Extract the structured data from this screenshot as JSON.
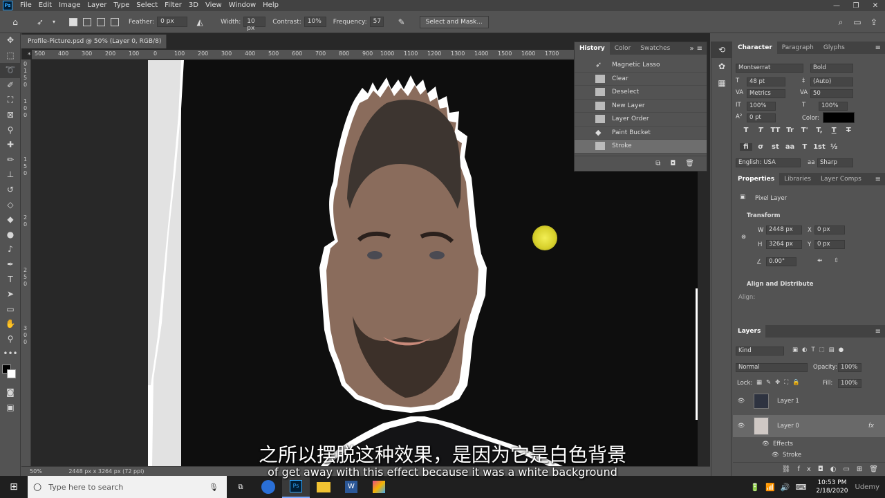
{
  "menubar": {
    "app_icon": "Ps",
    "items": [
      "File",
      "Edit",
      "Image",
      "Layer",
      "Type",
      "Select",
      "Filter",
      "3D",
      "View",
      "Window",
      "Help"
    ]
  },
  "options_bar": {
    "feather_label": "Feather:",
    "feather_value": "0 px",
    "width_label": "Width:",
    "width_value": "10 px",
    "contrast_label": "Contrast:",
    "contrast_value": "10%",
    "frequency_label": "Frequency:",
    "frequency_value": "57",
    "select_mask_label": "Select and Mask..."
  },
  "document": {
    "tab_title": "Profile-Picture.psd @ 50% (Layer 0, RGB/8) *",
    "ruler_h_labels": [
      "500",
      "400",
      "300",
      "200",
      "100",
      "0",
      "100",
      "200",
      "300",
      "400",
      "500",
      "600",
      "700",
      "800",
      "900",
      "1000",
      "1100",
      "1200",
      "1300",
      "1400",
      "1500",
      "1600",
      "1700"
    ],
    "ruler_v_labels": [
      "0",
      "1",
      "5",
      "0",
      "1",
      "0",
      "0",
      "1",
      "5",
      "0",
      "2",
      "0",
      "2",
      "5",
      "0",
      "3",
      "0",
      "0"
    ],
    "zoom": "50%",
    "doc_info": "2448 px x 3264 px (72 ppi)"
  },
  "history_panel": {
    "tabs": [
      "History",
      "Color",
      "Swatches"
    ],
    "items": [
      "Magnetic Lasso",
      "Clear",
      "Deselect",
      "New Layer",
      "Layer Order",
      "Paint Bucket",
      "Stroke"
    ],
    "active_index": 6
  },
  "character_panel": {
    "tabs": [
      "Character",
      "Paragraph",
      "Glyphs"
    ],
    "font_family": "Montserrat",
    "font_style": "Bold",
    "font_size": "48 pt",
    "leading": "(Auto)",
    "kerning": "Metrics",
    "tracking": "50",
    "vertical_scale": "100%",
    "horizontal_scale": "100%",
    "baseline_shift": "0 pt",
    "color_label": "Color:",
    "language": "English: USA",
    "antialias": "Sharp",
    "glyph_buttons_1": [
      "T",
      "T",
      "TT",
      "Tr",
      "T'",
      "T,",
      "T",
      "T"
    ],
    "glyph_buttons_2": [
      "fi",
      "σ",
      "st",
      "aa",
      "T",
      "1st",
      "½"
    ]
  },
  "properties_panel": {
    "tabs": [
      "Properties",
      "Libraries",
      "Layer Comps"
    ],
    "layer_type": "Pixel Layer",
    "transform_label": "Transform",
    "w_label": "W",
    "w_value": "2448 px",
    "h_label": "H",
    "h_value": "3264 px",
    "x_label": "X",
    "x_value": "0 px",
    "y_label": "Y",
    "y_value": "0 px",
    "angle_value": "0.00°",
    "align_label": "Align and Distribute",
    "align_sub": "Align:"
  },
  "layers_panel": {
    "title": "Layers",
    "filter_kind": "Kind",
    "blend_mode": "Normal",
    "opacity_label": "Opacity:",
    "opacity_value": "100%",
    "lock_label": "Lock:",
    "fill_label": "Fill:",
    "fill_value": "100%",
    "layers": [
      {
        "name": "Layer 1"
      },
      {
        "name": "Layer 0",
        "fx": "fx"
      }
    ],
    "effects_label": "Effects",
    "stroke_label": "Stroke"
  },
  "taskbar": {
    "search_placeholder": "Type here to search",
    "time": "10:53 PM",
    "date": "2/18/2020",
    "brand": "Udemy"
  },
  "captions": {
    "chinese": "之所以摆脱这种效果，是因为它是白色背景",
    "english": "of get away with this effect because it was a white background"
  },
  "colors": {
    "accent_ps": "#31a8ff",
    "panel_bg": "#535353",
    "highlight_cursor": "#e8e23a"
  }
}
